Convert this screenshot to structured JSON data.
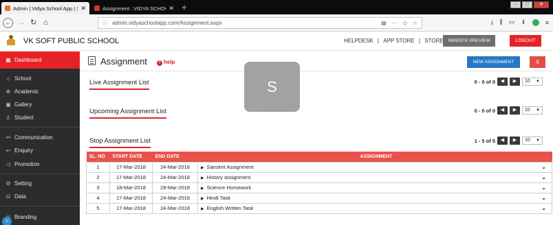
{
  "browser": {
    "tabs": [
      {
        "title": "Admin | Vidya School App | S",
        "active": true
      },
      {
        "title": "Assignment : VIDYA SCHOOL A",
        "active": false
      }
    ],
    "address": "admin.vidyaschoolapp.com/Assignment.aspx",
    "overflow_menu": "···"
  },
  "header": {
    "school_name": "VK SOFT PUBLIC SCHOOL",
    "links": [
      "HELPDESK",
      "APP STORE",
      "STORE"
    ],
    "link_separator": "|",
    "website_preview": "WEBSITE PREVIEW",
    "logout": "LOGOUT"
  },
  "sidebar": {
    "dashboard": {
      "label": "Dashboard",
      "icon": "grid-icon"
    },
    "items": [
      {
        "label": "School",
        "icon": "school-icon"
      },
      {
        "label": "Academic",
        "icon": "globe-icon"
      },
      {
        "label": "Gallery",
        "icon": "image-icon"
      },
      {
        "label": "Student",
        "icon": "person-icon"
      },
      {
        "label": "Communication",
        "icon": "link-icon"
      },
      {
        "label": "Enquiry",
        "icon": "reply-icon"
      },
      {
        "label": "Promotion",
        "icon": "megaphone-icon"
      },
      {
        "label": "Setting",
        "icon": "gear-icon"
      },
      {
        "label": "Data",
        "icon": "database-icon"
      },
      {
        "label": "Branding",
        "icon": "brand-icon"
      }
    ]
  },
  "page": {
    "title": "Assignment",
    "help": "help",
    "new_button": "NEW ASSIGNMENT",
    "close_button": "X"
  },
  "sections": [
    {
      "title": "Live Assignment List",
      "count": "0 - 0 of 0",
      "page_size": "10"
    },
    {
      "title": "Upcoming Assignment List",
      "count": "0 - 0 of 0",
      "page_size": "10"
    },
    {
      "title": "Stop Assignment List",
      "count": "1 - 5 of 5",
      "page_size": "10"
    }
  ],
  "table": {
    "columns": [
      "SL. NO",
      "START DATE",
      "END DATE",
      "ASSIGNMENT"
    ],
    "rows": [
      [
        "1",
        "17-Mar-2018",
        "24-Mar-2018",
        "Sanskrit Assignment"
      ],
      [
        "2",
        "17-Mar-2018",
        "24-Mar-2018",
        "History assignment"
      ],
      [
        "3",
        "18-Mar-2018",
        "29-Mar-2018",
        "Science Homework"
      ],
      [
        "4",
        "17-Mar-2018",
        "24-Mar-2018",
        "Hindi Task"
      ],
      [
        "5",
        "17-Mar-2018",
        "24-Mar-2018",
        "English Written Task"
      ]
    ]
  },
  "overlay": {
    "avatar_letter": "S"
  },
  "colors": {
    "brand_red": "#e52326",
    "primary_blue": "#2679c4",
    "sidebar_bg": "#2c2c2c",
    "table_header": "#e9524b"
  }
}
